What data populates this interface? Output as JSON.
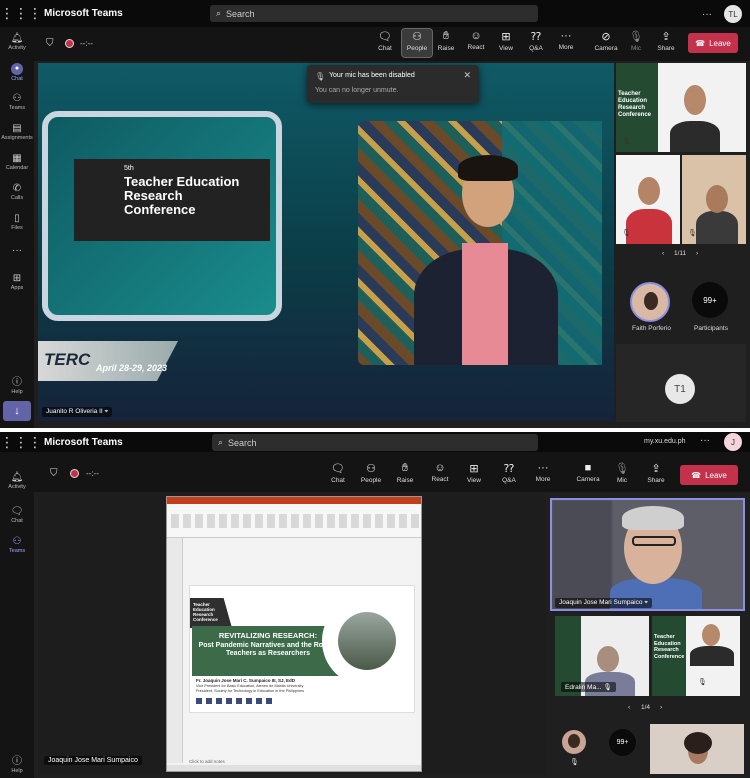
{
  "top": {
    "app_title": "Microsoft Teams",
    "search_placeholder": "Search",
    "user_initials": "TL",
    "rail": [
      {
        "label": "Activity",
        "icon": "bell-icon"
      },
      {
        "label": "Chat",
        "icon": "chat-icon"
      },
      {
        "label": "Teams",
        "icon": "teams-icon"
      },
      {
        "label": "Assignments",
        "icon": "assignments-icon"
      },
      {
        "label": "Calendar",
        "icon": "calendar-icon"
      },
      {
        "label": "Calls",
        "icon": "phone-icon"
      },
      {
        "label": "Files",
        "icon": "file-icon"
      },
      {
        "label": "Apps",
        "icon": "apps-icon"
      },
      {
        "label": "Help",
        "icon": "help-icon"
      }
    ],
    "timer": "--:--",
    "controls": [
      "Chat",
      "People",
      "Raise",
      "React",
      "View",
      "Q&A",
      "More",
      "Camera",
      "Mic",
      "Share"
    ],
    "leave_label": "Leave",
    "toast": {
      "title": "Your mic has been disabled",
      "message": "You can no longer unmute."
    },
    "stage": {
      "conf_number": "5th",
      "conf_title": "Teacher Education Research Conference",
      "erc_text": "TERC",
      "date_text": "April 28-29, 2023",
      "presenter_name": "Juanito R Oliveria II"
    },
    "side_tile_text": "Teacher Education Research Conference",
    "pager": "1/11",
    "faith_name": "Faith Porferio",
    "participants_count": "99+",
    "participants_label": "Participants",
    "self_initials": "T1"
  },
  "bottom": {
    "app_title": "Microsoft Teams",
    "search_placeholder": "Search",
    "org": "my.xu.edu.ph",
    "user_initials": "J",
    "rail": [
      {
        "label": "Activity",
        "icon": "bell-icon"
      },
      {
        "label": "Chat",
        "icon": "chat-icon"
      },
      {
        "label": "Teams",
        "icon": "teams-icon"
      },
      {
        "label": "Help",
        "icon": "help-icon"
      }
    ],
    "timer": "--:--",
    "controls": [
      "Chat",
      "People",
      "Raise",
      "React",
      "View",
      "Q&A",
      "More",
      "Camera",
      "Mic",
      "Share"
    ],
    "leave_label": "Leave",
    "slide": {
      "conf_small": "Teacher Education Research Conference",
      "headline": "REVITALIZING RESEARCH:",
      "subtitle": "Post Pandemic Narratives and the Role of Teachers as Researchers",
      "speaker": "Fr. Joaquin Jose Mari C. Sumpaico III, SJ, EdD",
      "role1": "Vice President for Basic Education, Ateneo de Manila University",
      "role2": "President, Society for Technology in Education in the Philippines",
      "notes": "Click to add notes"
    },
    "presenter_name": "Joaquin Jose Mari Sumpaico",
    "speaker_tile_name": "Joaquin Jose Mari Sumpaico",
    "edralin_name": "Edralin Ma...",
    "side_tile_text": "Teacher Education Research Conference",
    "pager": "1/4",
    "participants_count": "99+"
  },
  "colors": {
    "accent": "#6264a7",
    "leave": "#c4314b",
    "slide_green": "#3d6b4a"
  }
}
